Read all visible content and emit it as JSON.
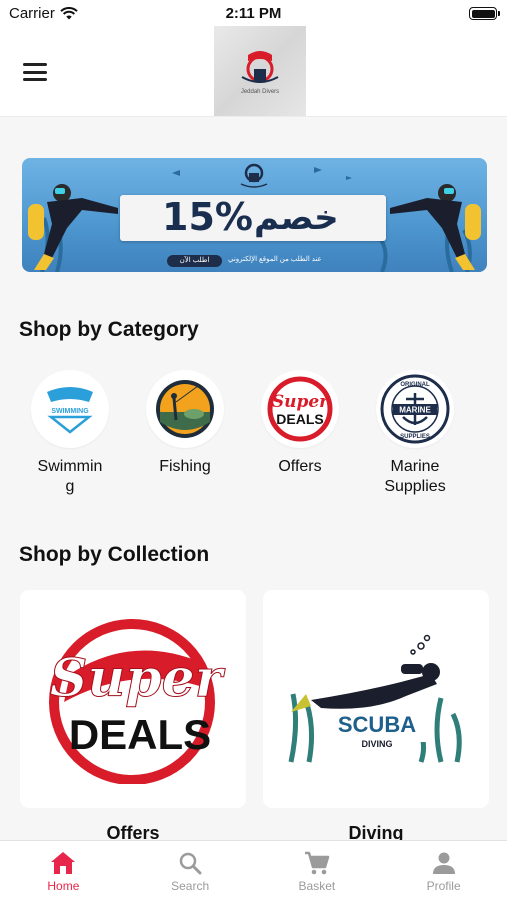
{
  "status_bar": {
    "carrier": "Carrier",
    "time": "2:11 PM"
  },
  "header": {
    "logo_caption": "Jeddah Divers"
  },
  "banner": {
    "promo_number": "15%",
    "promo_word": "خصم",
    "order_button": "اطلب الآن",
    "note": "عند الطلب من الموقع الإلكتروني"
  },
  "sections": {
    "category_title": "Shop by Category",
    "collection_title": "Shop by Collection"
  },
  "categories": [
    {
      "label_line1": "Swimmin",
      "label_line2": "g",
      "badge": "SWIMMING"
    },
    {
      "label_line1": "Fishing",
      "label_line2": ""
    },
    {
      "label_line1": "Offers",
      "label_line2": "",
      "badge_top": "Super",
      "badge_bottom": "DEALS"
    },
    {
      "label_line1": "Marine",
      "label_line2": "Supplies",
      "badge_ring_top": "ORIGINAL",
      "badge_center": "MARINE",
      "badge_ring_bottom": "SUPPLIES"
    }
  ],
  "collections": [
    {
      "label": "Offers",
      "badge_top": "Super",
      "badge_bottom": "DEALS"
    },
    {
      "label": "Diving",
      "badge_top": "SCUBA",
      "badge_bottom": "DIVING"
    }
  ],
  "tabs": [
    {
      "label": "Home",
      "icon": "home-icon",
      "active": true
    },
    {
      "label": "Search",
      "icon": "search-icon",
      "active": false
    },
    {
      "label": "Basket",
      "icon": "cart-icon",
      "active": false
    },
    {
      "label": "Profile",
      "icon": "person-icon",
      "active": false
    }
  ],
  "colors": {
    "accent": "#e8254a",
    "inactive": "#9b9b9b",
    "brand_navy": "#1d2d4a",
    "brand_red": "#d91c2a"
  }
}
